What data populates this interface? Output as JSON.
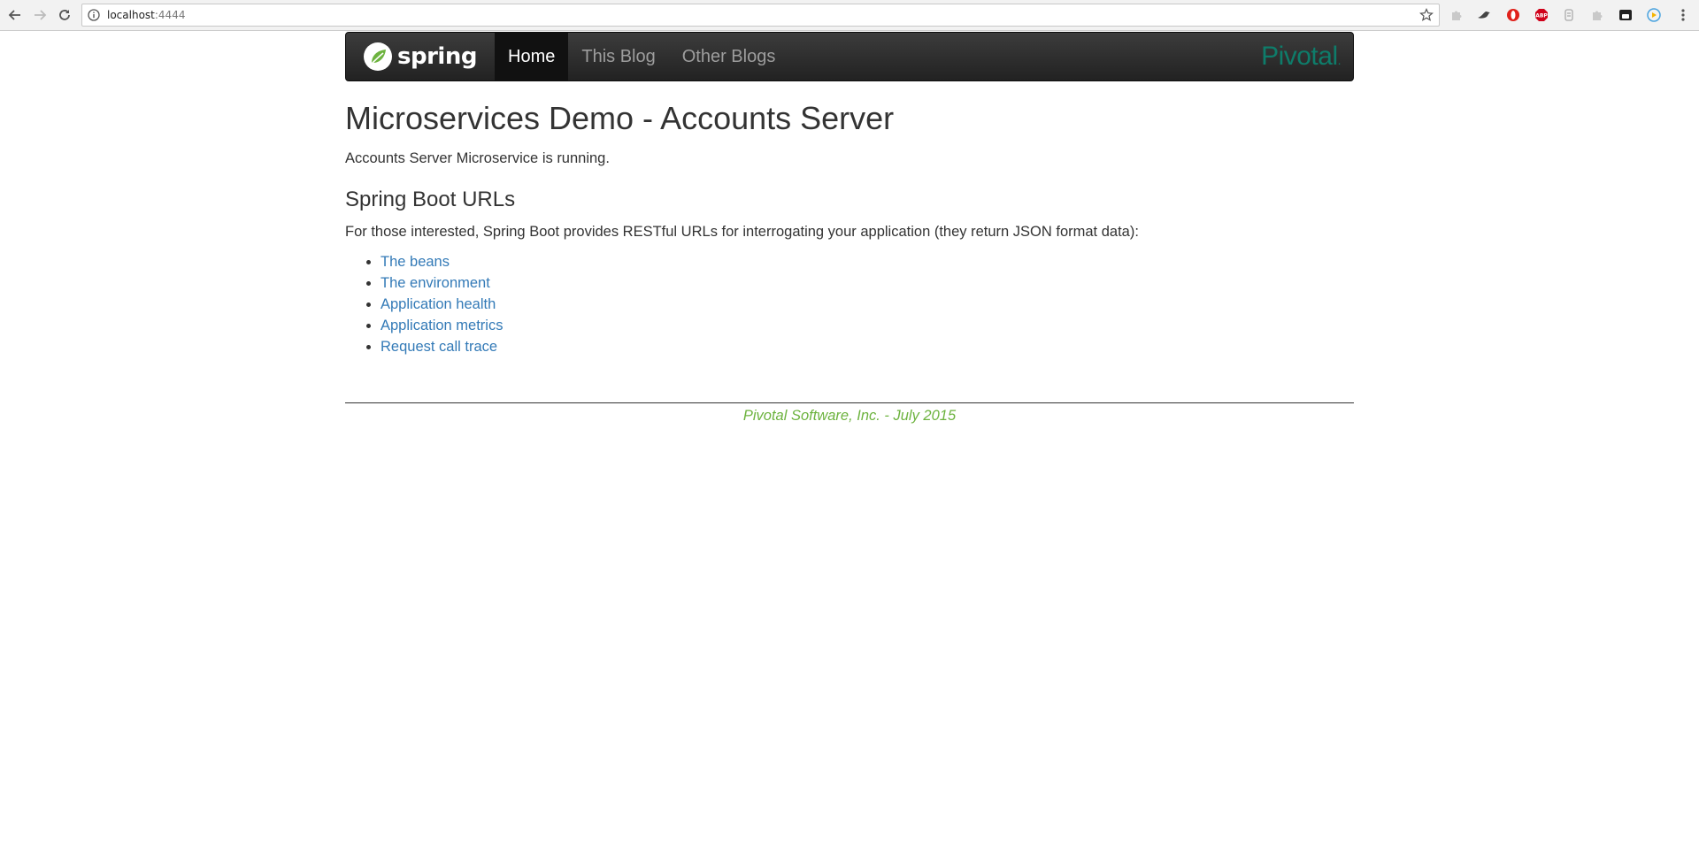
{
  "browser": {
    "url_host": "localhost",
    "url_port": ":4444"
  },
  "navbar": {
    "brand": "spring",
    "items": [
      {
        "label": "Home",
        "active": true
      },
      {
        "label": "This Blog",
        "active": false
      },
      {
        "label": "Other Blogs",
        "active": false
      }
    ],
    "partner_logo": "Pivotal",
    "partner_logo_suffix": "."
  },
  "main": {
    "title": "Microservices Demo - Accounts Server",
    "status": "Accounts Server Microservice is running.",
    "section_title": "Spring Boot URLs",
    "section_desc": "For those interested, Spring Boot provides RESTful URLs for interrogating your application (they return JSON format data):",
    "links": [
      "The beans",
      "The environment",
      "Application health",
      "Application metrics",
      "Request call trace"
    ]
  },
  "footer": {
    "text": "Pivotal Software, Inc. - July 2015"
  },
  "colors": {
    "navbar_bg": "#222222",
    "link": "#337ab7",
    "footer": "#6db33f",
    "pivotal_logo": "#0e7c6a"
  },
  "icons": {
    "back": "back-arrow-icon",
    "forward": "forward-arrow-icon",
    "reload": "reload-icon",
    "info": "info-icon",
    "star": "bookmark-star-icon",
    "extensions": [
      "puzzle-icon",
      "bird-icon",
      "opera-icon",
      "adblock-icon",
      "scissors-icon",
      "puzzle-icon",
      "pocket-icon",
      "chrome-cast-icon",
      "menu-dots-icon"
    ]
  }
}
